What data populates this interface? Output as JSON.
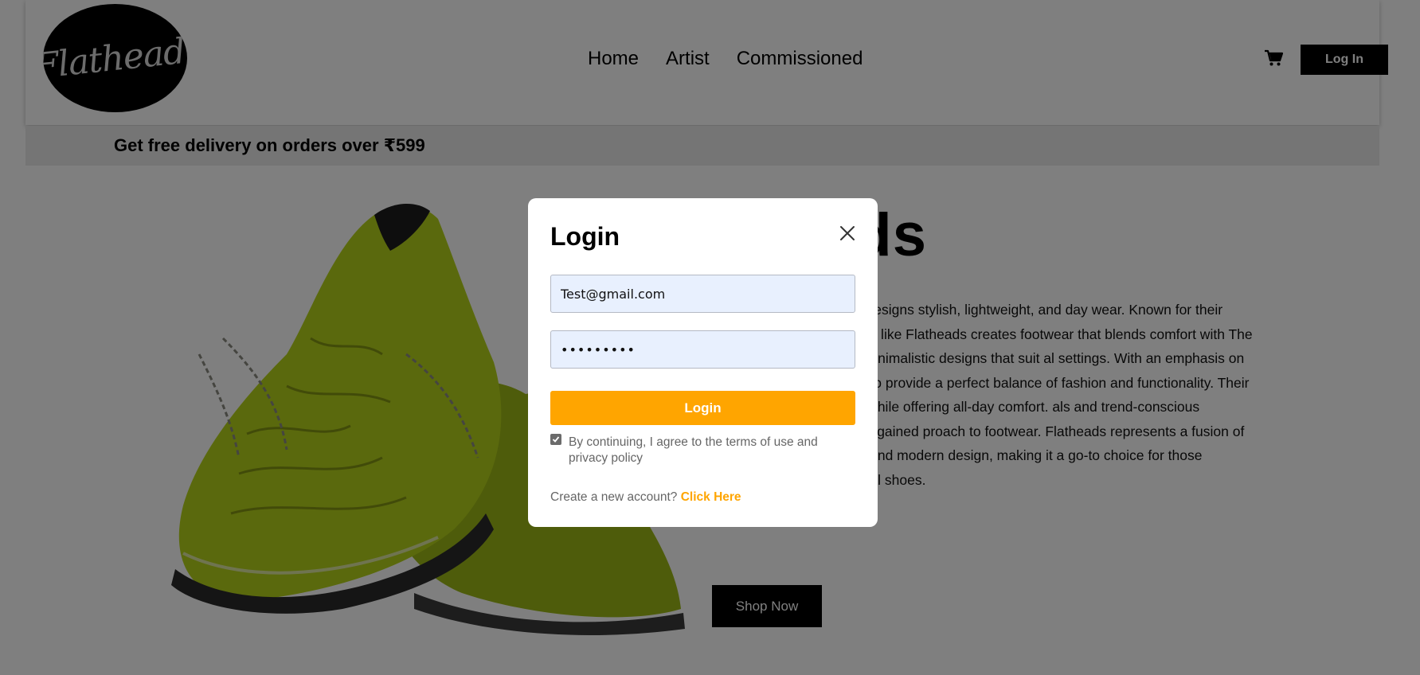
{
  "header": {
    "logo_text": "Flathead.",
    "nav": [
      "Home",
      "Artist",
      "Commissioned"
    ],
    "cart_icon": "cart-icon",
    "login_label": "Log In"
  },
  "promo": {
    "text": "Get free delivery on orders over ₹599"
  },
  "hero": {
    "title_visible": "ads",
    "description": "yle brand from India that designs stylish, lightweight, and day wear. Known for their innovative use of materials like Flatheads creates footwear that blends comfort with The brand focuses on sleek, minimalistic designs that suit al settings. With an emphasis on quality craftsmanship and o provide a perfect balance of fashion and functionality. Their le India’s diverse climate while offering all-day comfort. als and trend-conscious consumers, the brand has gained proach to footwear. Flatheads represents a fusion of innovation, sustainability, and modern design, making it a go-to choice for those seeking stylish yet practical shoes.",
    "shop_label": "Shop Now"
  },
  "modal": {
    "title": "Login",
    "close_icon": "close-icon",
    "email_value": "Test@gmail.com",
    "password_value": "•••••••••",
    "submit_label": "Login",
    "agree_checked": true,
    "agree_text": "By continuing, I agree to the terms of use and privacy policy",
    "create_prompt": "Create a new account? ",
    "create_link": "Click Here"
  },
  "colors": {
    "accent": "#ffa500",
    "input_bg": "#e8f0fe",
    "shoe_green": "#b5d21a",
    "overlay": "rgba(0,0,0,0.5)"
  }
}
